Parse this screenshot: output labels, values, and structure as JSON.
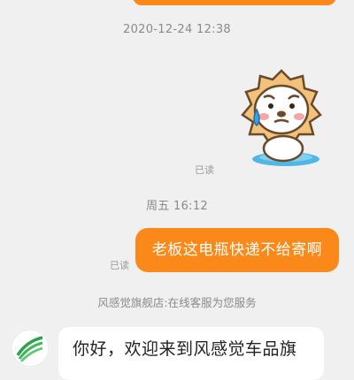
{
  "chat": {
    "timestamp_1": "2020-12-24 12:38",
    "sticker_read": "已读",
    "timestamp_2": "周五 16:12",
    "message_read": "已读",
    "outgoing_message": "老板这电瓶快递不给寄啊",
    "system_message": "风感觉旗舰店:在线客服为您服务",
    "incoming_message": "你好，欢迎来到风感觉车品旗",
    "colors": {
      "outgoing_bubble": "#fa8919",
      "background": "#f0f0f0",
      "incoming_bubble": "#ffffff"
    },
    "sticker_icon": "crying-lion-sticker",
    "avatar_icon": "store-logo-avatar"
  }
}
